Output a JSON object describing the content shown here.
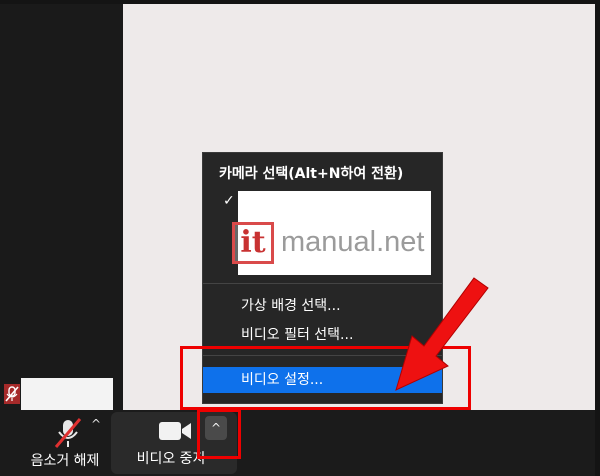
{
  "menu": {
    "header": "카메라 선택(Alt+N하여 전환)",
    "check": "✓",
    "items": [
      {
        "label": "가상 배경 선택..."
      },
      {
        "label": "비디오 필터 선택..."
      },
      {
        "label": "비디오 설정..."
      }
    ]
  },
  "toolbar": {
    "mute_label": "음소거 해제",
    "video_label": "비디오 중지",
    "caret": "^"
  },
  "watermark": {
    "box_text": "it",
    "text": "manual.net"
  },
  "icons": {
    "muted_mic": "mic-off-icon",
    "mic_off_toolbar": "mic-off-icon",
    "video": "video-camera-icon",
    "caret": "caret-up-icon"
  },
  "colors": {
    "menu_bg": "#262626",
    "selected": "#0e71eb",
    "annotation_red": "#ee0000",
    "muted_red": "#a62a2a"
  }
}
